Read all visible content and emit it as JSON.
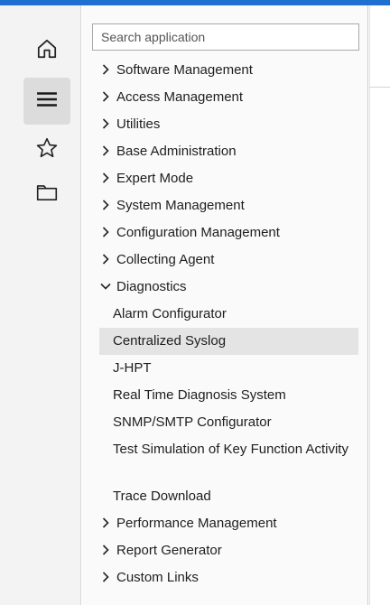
{
  "nav_rail": {
    "buttons": [
      {
        "icon": "home-icon",
        "active": false
      },
      {
        "icon": "menu-icon",
        "active": true
      },
      {
        "icon": "star-icon",
        "active": false
      },
      {
        "icon": "folder-icon",
        "active": false
      }
    ]
  },
  "search": {
    "placeholder": "Search application",
    "value": ""
  },
  "menu": {
    "items": [
      {
        "label": "Software Management",
        "state": "collapsed"
      },
      {
        "label": "Access Management",
        "state": "collapsed"
      },
      {
        "label": "Utilities",
        "state": "collapsed"
      },
      {
        "label": "Base Administration",
        "state": "collapsed"
      },
      {
        "label": "Expert Mode",
        "state": "collapsed"
      },
      {
        "label": "System Management",
        "state": "collapsed"
      },
      {
        "label": "Configuration Management",
        "state": "collapsed"
      },
      {
        "label": "Collecting Agent",
        "state": "collapsed"
      },
      {
        "label": "Diagnostics",
        "state": "expanded"
      },
      {
        "label": "Performance Management",
        "state": "collapsed"
      },
      {
        "label": "Report Generator",
        "state": "collapsed"
      },
      {
        "label": "Custom Links",
        "state": "collapsed"
      }
    ],
    "diagnostics_children": [
      {
        "label": "Alarm Configurator"
      },
      {
        "label": "Centralized Syslog",
        "selected": true
      },
      {
        "label": "J-HPT"
      },
      {
        "label": "Real Time Diagnosis System"
      },
      {
        "label": "SNMP/SMTP Configurator"
      },
      {
        "label": "Test Simulation of Key Function Activity"
      },
      {
        "label": "Trace Download"
      }
    ]
  },
  "colors": {
    "accent": "#1f6fd1",
    "selected_bg": "#e4e4e4",
    "rail_bg": "#f3f3f3"
  }
}
